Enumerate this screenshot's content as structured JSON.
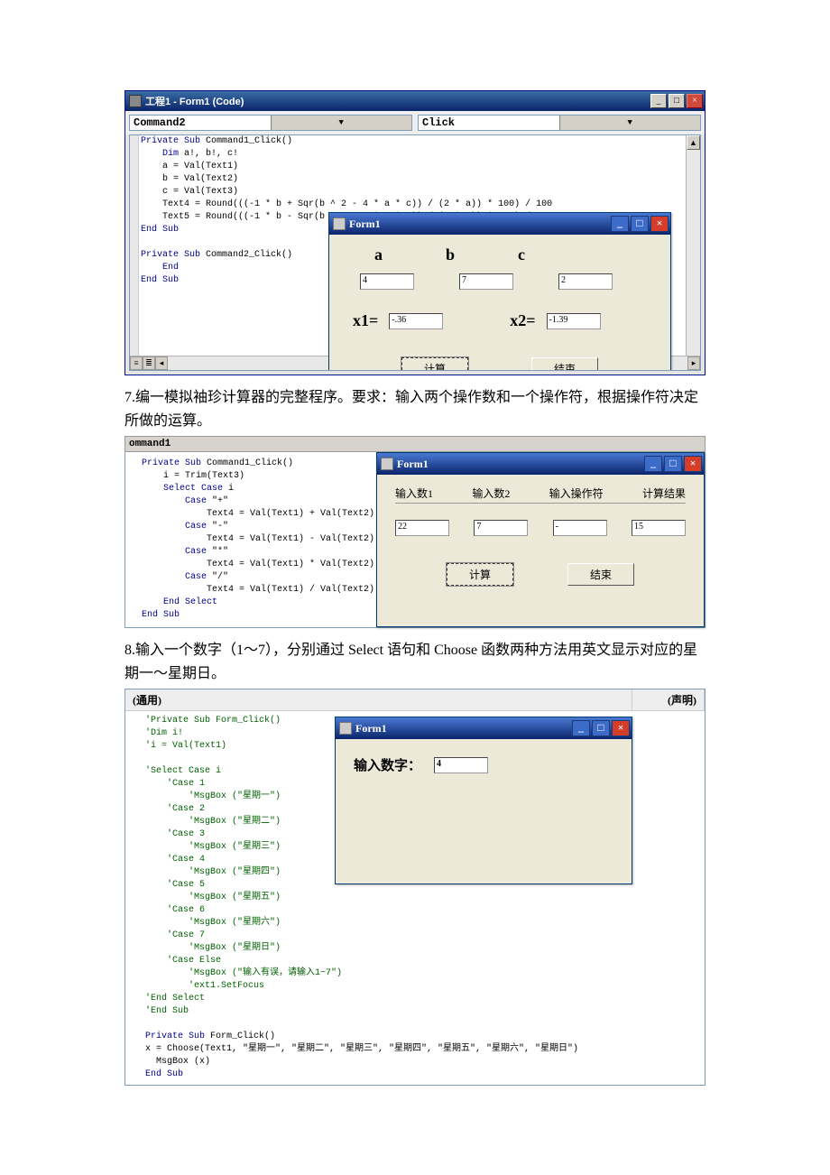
{
  "section1": {
    "window_title": "工程1 - Form1 (Code)",
    "combo_left": "Command2",
    "combo_right": "Click",
    "code": "Private Sub Command1_Click()\n    Dim a!, b!, c!\n    a = Val(Text1)\n    b = Val(Text2)\n    c = Val(Text3)\n    Text4 = Round(((-1 * b + Sqr(b ^ 2 - 4 * a * c)) / (2 * a)) * 100) / 100\n    Text5 = Round(((-1 * b - Sqr(b ^ 2 - 4 * a * c)) / (2 * a)) * 100) / 100\nEnd Sub\n\nPrivate Sub Command2_Click()\n    End\nEnd Sub",
    "form1": {
      "title": "Form1",
      "labels": {
        "a": "a",
        "b": "b",
        "c": "c",
        "x1": "x1=",
        "x2": "x2="
      },
      "vals": {
        "a": "4",
        "b": "7",
        "c": "2",
        "x1": "-.36",
        "x2": "-1.39"
      },
      "btn_calc": "计算",
      "btn_end": "结束"
    }
  },
  "q7": "7.编一模拟袖珍计算器的完整程序。要求：输入两个操作数和一个操作符，根据操作符决定所做的运算。",
  "section2": {
    "slice_text": "ommand1",
    "code": "Private Sub Command1_Click()\n    i = Trim(Text3)\n    Select Case i\n        Case \"+\"\n            Text4 = Val(Text1) + Val(Text2)\n        Case \"-\"\n            Text4 = Val(Text1) - Val(Text2)\n        Case \"*\"\n            Text4 = Val(Text1) * Val(Text2)\n        Case \"/\"\n            Text4 = Val(Text1) / Val(Text2)\n    End Select\nEnd Sub",
    "form1": {
      "title": "Form1",
      "hdr1": "输入数1",
      "hdr2": "输入数2",
      "hdr3": "输入操作符",
      "hdr4": "计算结果",
      "v1": "22",
      "v2": "7",
      "v3": "-",
      "v4": "15",
      "btn_calc": "计算",
      "btn_end": "结束"
    }
  },
  "q8": "8.输入一个数字（1～7），分别通过 Select 语句和 Choose 函数两种方法用英文显示对应的星期一～星期日。",
  "section3": {
    "combo_left": "(通用)",
    "combo_right": "(声明)",
    "code_comment": "'Private Sub Form_Click()\n'Dim i!\n'i = Val(Text1)\n\n'Select Case i\n    'Case 1\n        'MsgBox (\"星期一\")\n    'Case 2\n        'MsgBox (\"星期二\")\n    'Case 3\n        'MsgBox (\"星期三\")\n    'Case 4\n        'MsgBox (\"星期四\")\n    'Case 5\n        'MsgBox (\"星期五\")\n    'Case 6\n        'MsgBox (\"星期六\")\n    'Case 7\n        'MsgBox (\"星期日\")\n    'Case Else\n        'MsgBox (\"输入有误，请输入1~7\")\n        'ext1.SetFocus\n'End Select\n'End Sub",
    "code_live": "Private Sub Form_Click()\nx = Choose(Text1, \"星期一\", \"星期二\", \"星期三\", \"星期四\", \"星期五\", \"星期六\", \"星期日\")\n  MsgBox (x)\nEnd Sub",
    "form1": {
      "title": "Form1",
      "label": "输入数字：",
      "value": "4"
    }
  }
}
